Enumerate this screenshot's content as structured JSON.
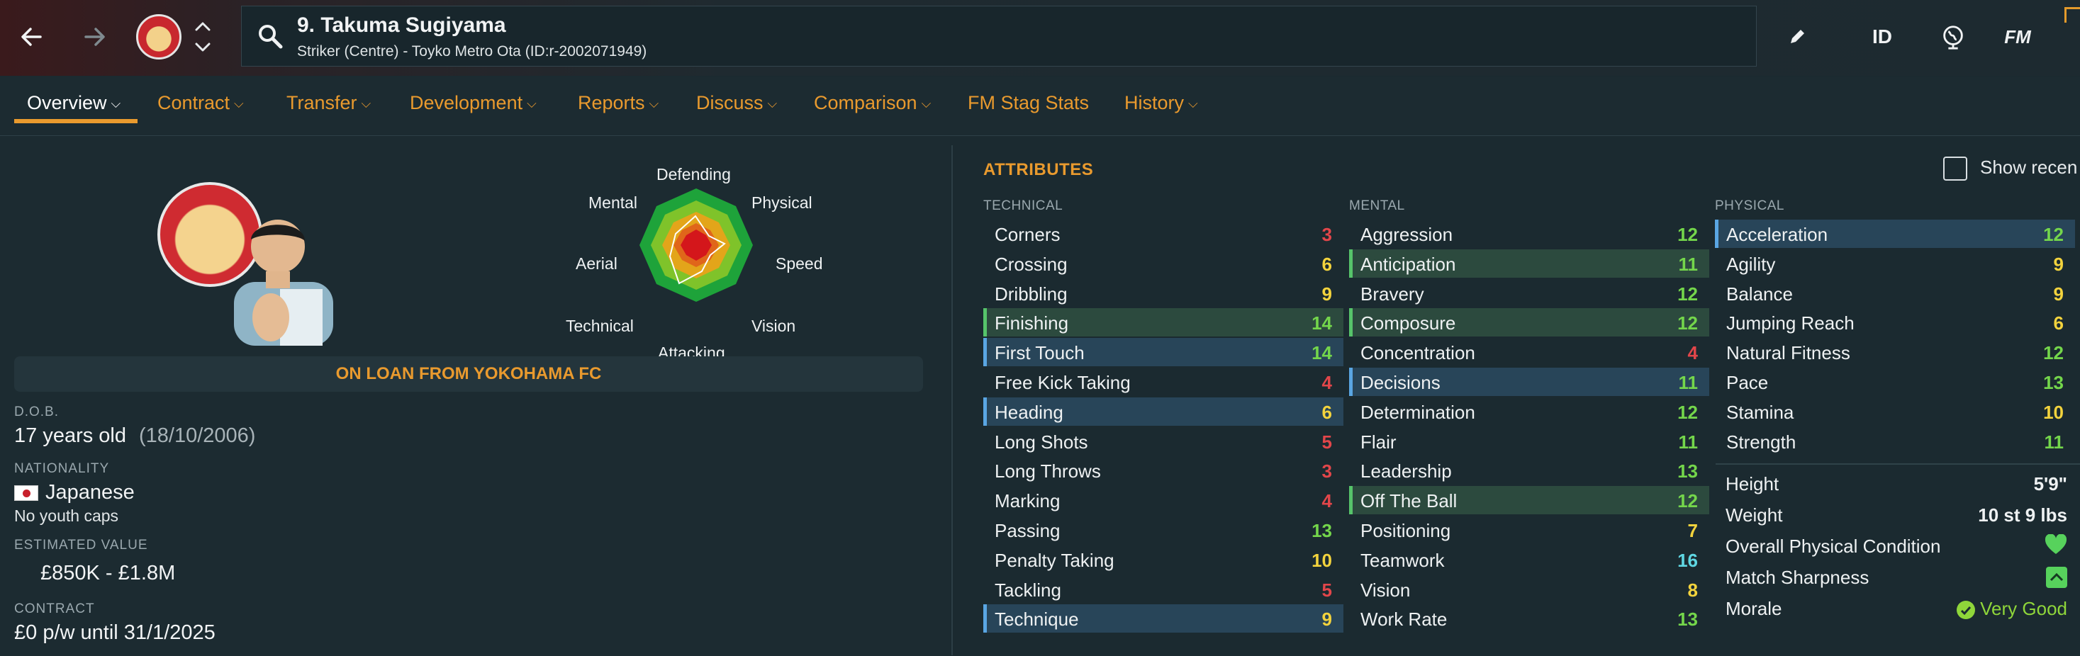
{
  "header": {
    "title": "9. Takuma Sugiyama",
    "subtitle": "Striker (Centre) - Toyko Metro Ota (ID:r-2002071949)",
    "id_label": "ID",
    "fm_label": "FM"
  },
  "tabs": [
    {
      "label": "Overview"
    },
    {
      "label": "Contract"
    },
    {
      "label": "Transfer"
    },
    {
      "label": "Development"
    },
    {
      "label": "Reports"
    },
    {
      "label": "Discuss"
    },
    {
      "label": "Comparison"
    },
    {
      "label": "FM Stag Stats"
    },
    {
      "label": "History"
    }
  ],
  "radar": {
    "labels": {
      "defending": "Defending",
      "physical": "Physical",
      "speed": "Speed",
      "vision": "Vision",
      "attacking": "Attacking",
      "technical": "Technical",
      "aerial": "Aerial",
      "mental": "Mental"
    }
  },
  "profile": {
    "loan_text": "ON LOAN FROM YOKOHAMA FC",
    "dob_label": "D.O.B.",
    "age": "17 years old",
    "dob": "(18/10/2006)",
    "nationality_label": "NATIONALITY",
    "nationality": "Japanese",
    "caps": "No youth caps",
    "value_label": "ESTIMATED VALUE",
    "value": "£850K - £1.8M",
    "contract_label": "CONTRACT",
    "contract": "£0 p/w until 31/1/2025"
  },
  "attributes": {
    "heading": "ATTRIBUTES",
    "show_recent": "Show recen",
    "technical_title": "TECHNICAL",
    "mental_title": "MENTAL",
    "physical_title": "PHYSICAL",
    "technical": [
      {
        "name": "Corners",
        "value": "3"
      },
      {
        "name": "Crossing",
        "value": "6"
      },
      {
        "name": "Dribbling",
        "value": "9"
      },
      {
        "name": "Finishing",
        "value": "14"
      },
      {
        "name": "First Touch",
        "value": "14"
      },
      {
        "name": "Free Kick Taking",
        "value": "4"
      },
      {
        "name": "Heading",
        "value": "6"
      },
      {
        "name": "Long Shots",
        "value": "5"
      },
      {
        "name": "Long Throws",
        "value": "3"
      },
      {
        "name": "Marking",
        "value": "4"
      },
      {
        "name": "Passing",
        "value": "13"
      },
      {
        "name": "Penalty Taking",
        "value": "10"
      },
      {
        "name": "Tackling",
        "value": "5"
      },
      {
        "name": "Technique",
        "value": "9"
      }
    ],
    "mental": [
      {
        "name": "Aggression",
        "value": "12"
      },
      {
        "name": "Anticipation",
        "value": "11"
      },
      {
        "name": "Bravery",
        "value": "12"
      },
      {
        "name": "Composure",
        "value": "12"
      },
      {
        "name": "Concentration",
        "value": "4"
      },
      {
        "name": "Decisions",
        "value": "11"
      },
      {
        "name": "Determination",
        "value": "12"
      },
      {
        "name": "Flair",
        "value": "11"
      },
      {
        "name": "Leadership",
        "value": "13"
      },
      {
        "name": "Off The Ball",
        "value": "12"
      },
      {
        "name": "Positioning",
        "value": "7"
      },
      {
        "name": "Teamwork",
        "value": "16"
      },
      {
        "name": "Vision",
        "value": "8"
      },
      {
        "name": "Work Rate",
        "value": "13"
      }
    ],
    "physical": [
      {
        "name": "Acceleration",
        "value": "12"
      },
      {
        "name": "Agility",
        "value": "9"
      },
      {
        "name": "Balance",
        "value": "9"
      },
      {
        "name": "Jumping Reach",
        "value": "6"
      },
      {
        "name": "Natural Fitness",
        "value": "12"
      },
      {
        "name": "Pace",
        "value": "13"
      },
      {
        "name": "Stamina",
        "value": "10"
      },
      {
        "name": "Strength",
        "value": "11"
      }
    ],
    "info": {
      "height_label": "Height",
      "height": "5'9\"",
      "weight_label": "Weight",
      "weight": "10 st 9 lbs",
      "condition_label": "Overall Physical Condition",
      "sharpness_label": "Match Sharpness",
      "morale_label": "Morale",
      "morale": "Very Good"
    }
  },
  "colors": {
    "accent": "#e99a2e",
    "low": "#e2464a",
    "mid": "#f3d33d",
    "good": "#74d64b",
    "high": "#5fd7e3"
  }
}
